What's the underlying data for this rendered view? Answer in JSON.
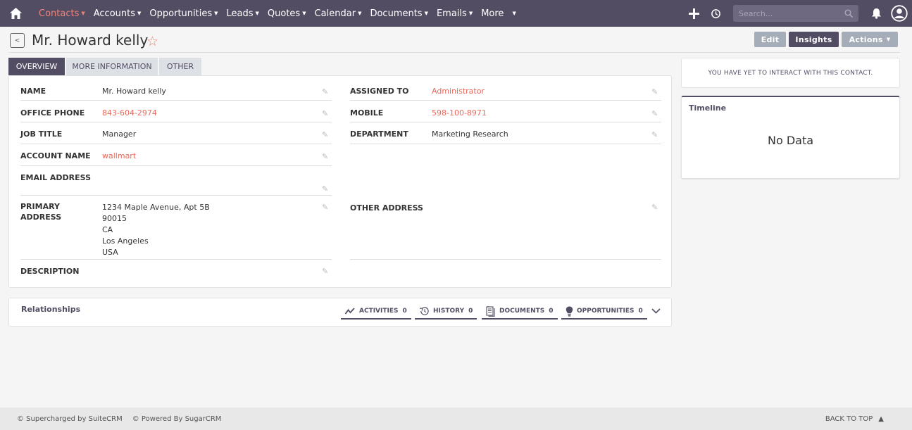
{
  "nav": {
    "items": [
      {
        "label": "Contacts",
        "active": true
      },
      {
        "label": "Accounts"
      },
      {
        "label": "Opportunities"
      },
      {
        "label": "Leads"
      },
      {
        "label": "Quotes"
      },
      {
        "label": "Calendar"
      },
      {
        "label": "Documents"
      },
      {
        "label": "Emails"
      },
      {
        "label": "More"
      }
    ],
    "search_placeholder": "Search..."
  },
  "header": {
    "title": "Mr. Howard kelly",
    "star_glyph": "☆",
    "back_glyph": "<"
  },
  "actions": {
    "edit": "Edit",
    "insights": "Insights",
    "actions": "Actions"
  },
  "tabs": [
    "OVERVIEW",
    "MORE INFORMATION",
    "OTHER"
  ],
  "fields": {
    "name": {
      "label": "NAME",
      "value": "Mr. Howard kelly"
    },
    "assigned_to": {
      "label": "ASSIGNED TO",
      "value": "Administrator"
    },
    "office_phone": {
      "label": "OFFICE PHONE",
      "value": "843-604-2974"
    },
    "mobile": {
      "label": "MOBILE",
      "value": "598-100-8971"
    },
    "job_title": {
      "label": "JOB TITLE",
      "value": "Manager"
    },
    "department": {
      "label": "DEPARTMENT",
      "value": "Marketing Research"
    },
    "account_name": {
      "label": "ACCOUNT NAME",
      "value": "wallmart"
    },
    "email_address": {
      "label": "EMAIL ADDRESS",
      "value": ""
    },
    "primary_address": {
      "label_line1": "PRIMARY",
      "label_line2": "ADDRESS",
      "lines": [
        "1234 Maple Avenue, Apt 5B",
        "90015",
        "CA",
        "Los Angeles",
        "USA"
      ]
    },
    "other_address": {
      "label": "OTHER ADDRESS",
      "value": ""
    },
    "description": {
      "label": "DESCRIPTION",
      "value": ""
    }
  },
  "relationships": {
    "title": "Relationships",
    "tabs": [
      {
        "label": "ACTIVITIES",
        "count": "0",
        "icon": "activity-icon"
      },
      {
        "label": "HISTORY",
        "count": "0",
        "icon": "history-icon"
      },
      {
        "label": "DOCUMENTS",
        "count": "0",
        "icon": "document-icon"
      },
      {
        "label": "OPPORTUNITIES",
        "count": "0",
        "icon": "lightbulb-icon"
      }
    ]
  },
  "insights": {
    "interact_text": "YOU HAVE YET TO INTERACT WITH THIS CONTACT.",
    "timeline_title": "Timeline",
    "timeline_empty": "No Data"
  },
  "footer": {
    "suitecrm": "© Supercharged by SuiteCRM",
    "sugarcrm": "© Powered By SugarCRM",
    "back_to_top": "BACK TO TOP"
  },
  "colors": {
    "navbar": "#534d64",
    "accent": "#f08377",
    "link": "#e8685a"
  }
}
